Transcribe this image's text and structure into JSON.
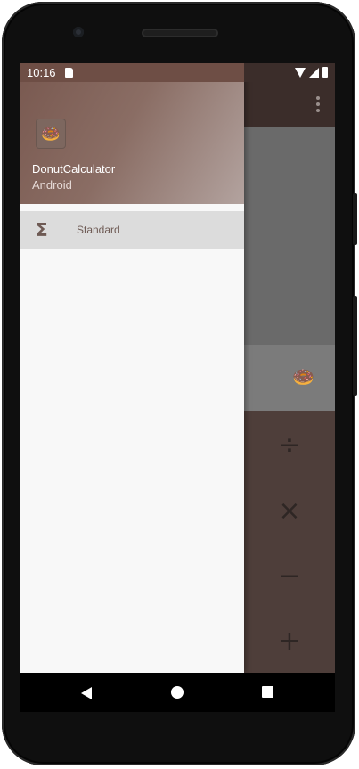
{
  "status_bar": {
    "time": "10:16"
  },
  "drawer": {
    "header": {
      "title": "DonutCalculator",
      "subtitle": "Android"
    },
    "items": [
      {
        "icon": "sigma-icon",
        "label": "Standard"
      }
    ]
  },
  "calculator": {
    "result_icon": "donut-icon",
    "operators": [
      "÷",
      "×",
      "−",
      "+"
    ]
  },
  "colors": {
    "toolbar": "#3b2d2a",
    "drawer_header_start": "#7a5a51",
    "drawer_header_end": "#b3a39f",
    "accent": "#6e5a54",
    "nav_selected_bg": "#dcdcdc"
  }
}
